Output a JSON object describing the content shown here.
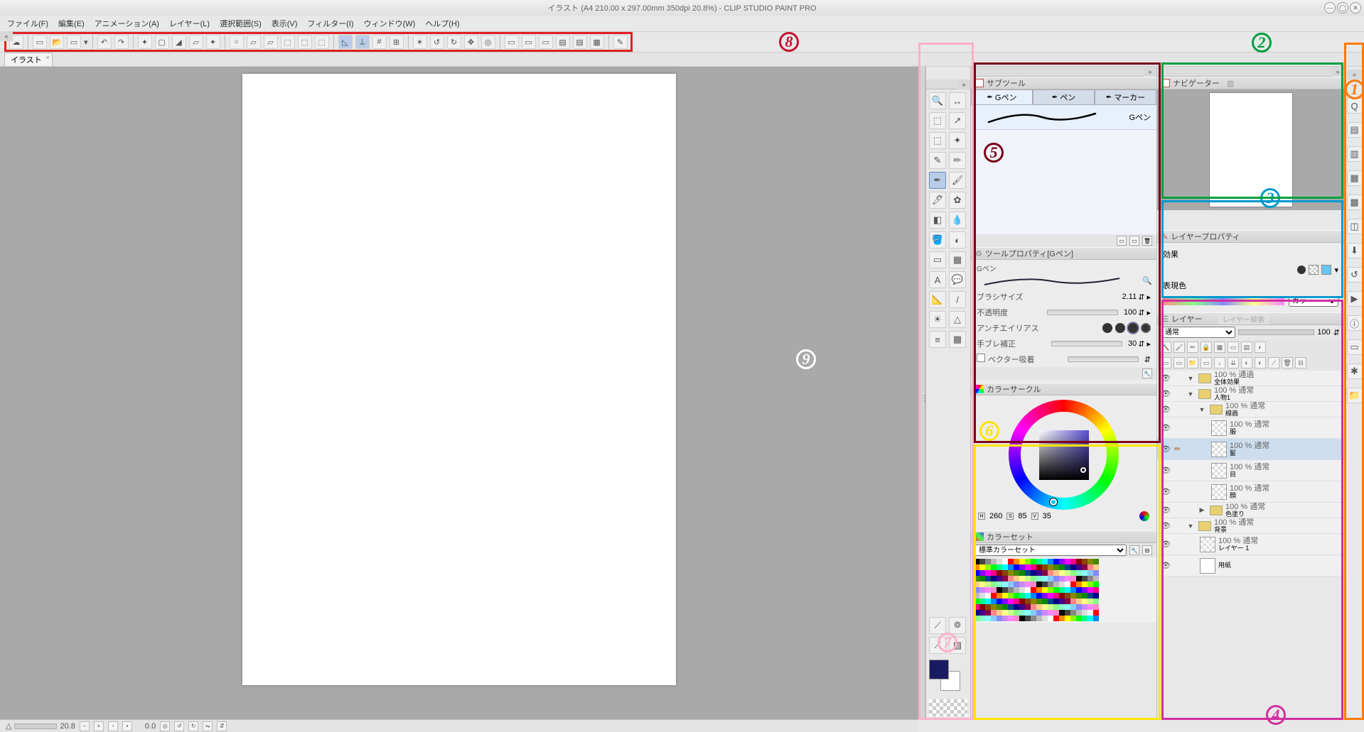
{
  "title": "イラスト (A4 210.00 x 297.00mm 350dpi 20.8%)  - CLIP STUDIO PAINT PRO",
  "menu": [
    "ファイル(F)",
    "編集(E)",
    "アニメーション(A)",
    "レイヤー(L)",
    "選択範囲(S)",
    "表示(V)",
    "フィルター(I)",
    "ウィンドウ(W)",
    "ヘルプ(H)"
  ],
  "doc_tab": "イラスト",
  "status": {
    "zoom": "20.8",
    "angle": "0.0"
  },
  "subtool": {
    "title": "サブツール",
    "tabs": [
      "Gペン",
      "ペン",
      "マーカー"
    ],
    "preview_label": "Gペン"
  },
  "tool_property": {
    "title": "ツールプロパティ[Gペン]",
    "tool_name": "Gペン",
    "rows": [
      {
        "label": "ブラシサイズ",
        "value": "2.11"
      },
      {
        "label": "不透明度",
        "value": "100"
      },
      {
        "label": "アンチエイリアス",
        "value": ""
      },
      {
        "label": "手ブレ補正",
        "value": "30"
      },
      {
        "label": "ベクター吸着",
        "value": ""
      }
    ]
  },
  "color_circle": {
    "title": "カラーサークル",
    "h": "260",
    "s": "85",
    "v": "35"
  },
  "color_set": {
    "title": "カラーセット",
    "preset": "標準カラーセット"
  },
  "navigator": {
    "title": "ナビゲーター"
  },
  "layer_property": {
    "title": "レイヤープロパティ",
    "effect_label": "効果",
    "mode_label": "表現色",
    "mode_value": "カラー"
  },
  "layer_panel": {
    "title": "レイヤー",
    "search": "レイヤー検索",
    "blend": "通常",
    "opacity": "100",
    "layers": [
      {
        "type": "folder",
        "indent": 0,
        "open": true,
        "name": "全体効果",
        "mode": "100 % 通過"
      },
      {
        "type": "folder",
        "indent": 0,
        "open": true,
        "name": "人物1",
        "mode": "100 % 通常"
      },
      {
        "type": "folder",
        "indent": 1,
        "open": true,
        "name": "線画",
        "mode": "100 % 通常"
      },
      {
        "type": "layer",
        "indent": 2,
        "name": "服",
        "mode": "100 % 通常"
      },
      {
        "type": "layer",
        "indent": 2,
        "name": "髪",
        "mode": "100 % 通常",
        "sel": true,
        "pencil": true
      },
      {
        "type": "layer",
        "indent": 2,
        "name": "目",
        "mode": "100 % 通常"
      },
      {
        "type": "layer",
        "indent": 2,
        "name": "顔",
        "mode": "100 % 通常"
      },
      {
        "type": "folder",
        "indent": 1,
        "open": false,
        "name": "色塗り",
        "mode": "100 % 通常"
      },
      {
        "type": "folder",
        "indent": 0,
        "open": true,
        "name": "背景",
        "mode": "100 % 通常"
      },
      {
        "type": "layer",
        "indent": 1,
        "name": "レイヤー 1",
        "mode": "100 % 通常"
      },
      {
        "type": "paper",
        "indent": 1,
        "name": "用紙",
        "mode": ""
      }
    ]
  }
}
